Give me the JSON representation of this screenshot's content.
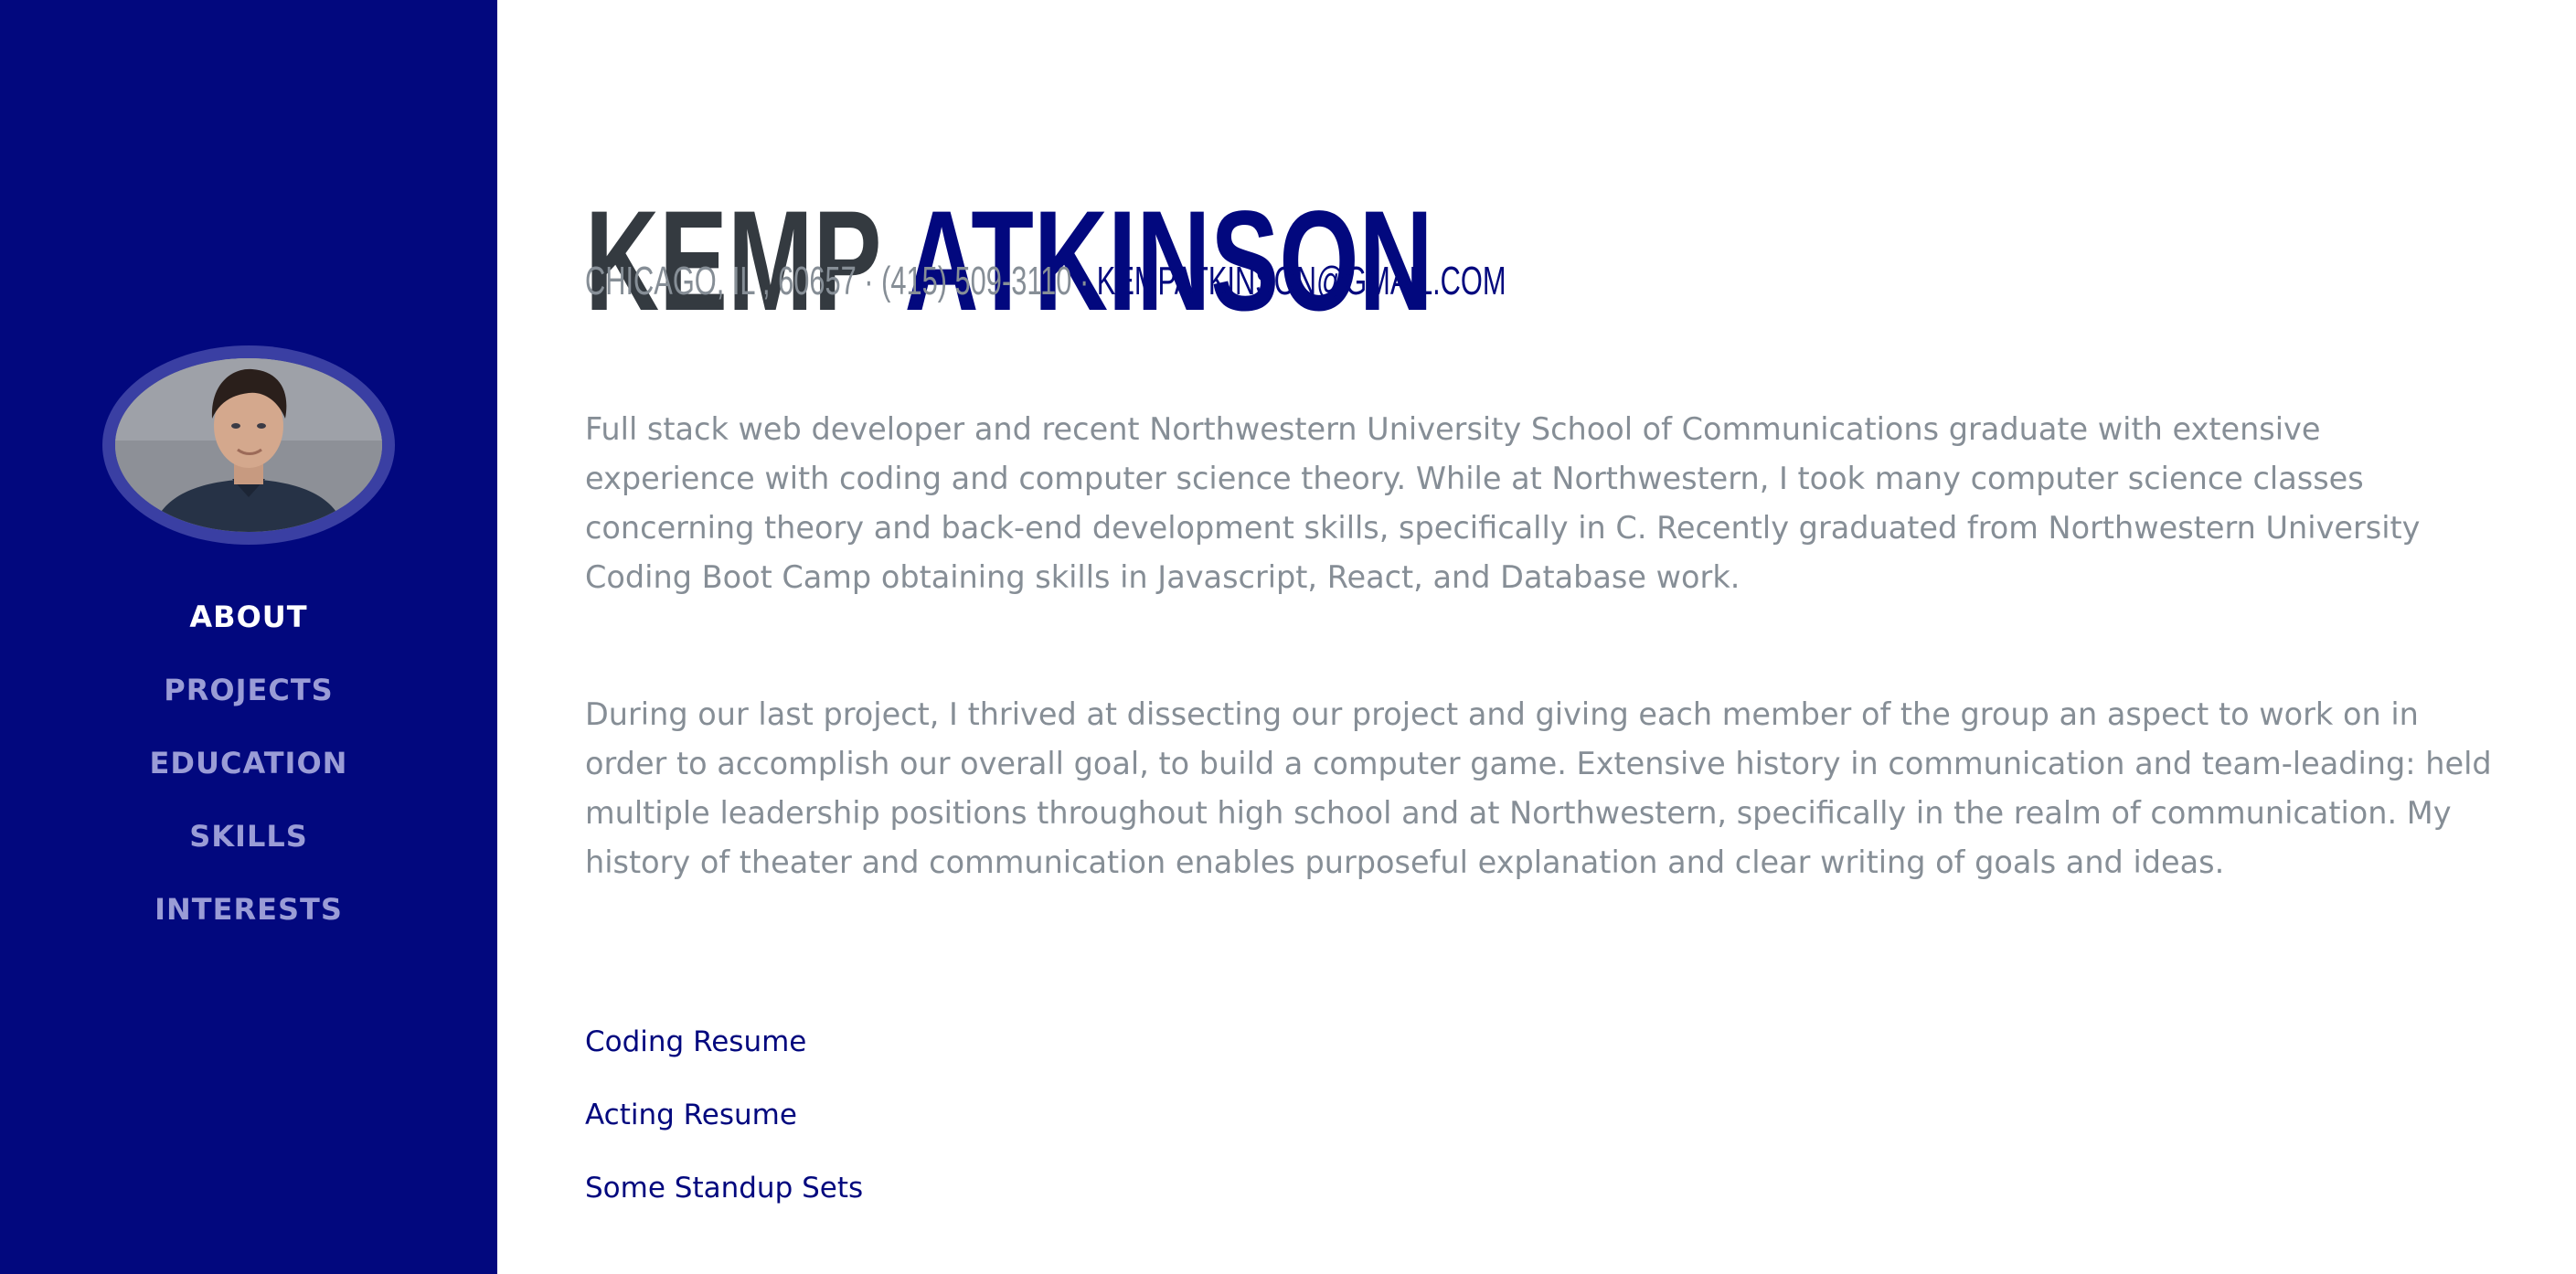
{
  "header": {
    "first_name": "KEMP",
    "last_name": "ATKINSON",
    "location": "CHICAGO, IL , 60657 · (415) 509-3110 · ",
    "email": "KEMPATKINSON@GMAIL.COM"
  },
  "sidebar": {
    "nav": [
      {
        "label": "ABOUT",
        "active": true
      },
      {
        "label": "PROJECTS",
        "active": false
      },
      {
        "label": "EDUCATION",
        "active": false
      },
      {
        "label": "SKILLS",
        "active": false
      },
      {
        "label": "INTERESTS",
        "active": false
      }
    ]
  },
  "about": {
    "paragraph1": "Full stack web developer and recent Northwestern University School of Communications graduate with extensive experience with coding and computer science theory. While at Northwestern, I took many computer science classes concerning theory and back-end development skills, specifically in C. Recently graduated from Northwestern University Coding Boot Camp obtaining skills in Javascript, React, and Database work.",
    "paragraph2": "During our last project, I thrived at dissecting our project and giving each member of the group an aspect to work on in order to accomplish our overall goal, to build a computer game. Extensive history in communication and team-leading: held multiple leadership positions throughout high school and at Northwestern, specifically in the realm of communication. My history of theater and communication enables purposeful explanation and clear writing of goals and ideas."
  },
  "links": [
    "Coding Resume",
    "Acting Resume",
    "Some Standup Sets"
  ],
  "colors": {
    "sidebar_bg": "#02087e",
    "accent": "#02087e",
    "name_dark": "#343a40",
    "body_text": "#868e96",
    "nav_inactive": "#9a9cd6"
  }
}
